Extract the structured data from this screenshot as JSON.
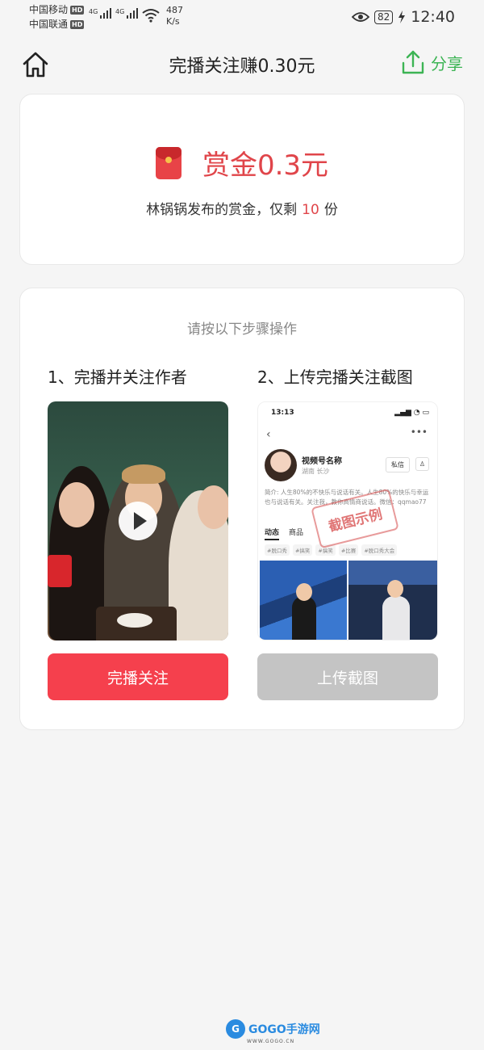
{
  "status_bar": {
    "carrier1": "中国移动",
    "carrier2": "中国联通",
    "hd": "HD",
    "network": "4G",
    "speed_value": "487",
    "speed_unit": "K/s",
    "battery": "82",
    "time": "12:40"
  },
  "header": {
    "title": "完播关注赚0.30元",
    "share_label": "分享",
    "accent_color": "#3cb454"
  },
  "bounty": {
    "amount_label": "赏金0.3元",
    "desc_prefix": "林锅锅发布的赏金，仅剩",
    "remaining": "10",
    "desc_suffix": "份",
    "accent_color": "#e0454a"
  },
  "steps": {
    "hint": "请按以下步骤操作",
    "step1_title": "1、完播并关注作者",
    "step2_title": "2、上传完播关注截图",
    "step1_button": "完播关注",
    "step2_button": "上传截图",
    "primary_color": "#f5404d",
    "disabled_color": "#c4c4c4"
  },
  "example": {
    "time": "13:13",
    "channel_name": "视频号名称",
    "location": "湖南 长沙",
    "dm_label": "私信",
    "bio": "简介: 人生80%的不快乐与说话有关。人生80%的快乐与幸运也与说话有关。关注我，教你高情商说话。微信：qqmao77",
    "tab_active": "动态",
    "tab_other": "商品",
    "tags": [
      "#脱口秀",
      "#搞笑",
      "#搞笑",
      "#比赛",
      "#脱口秀大会"
    ],
    "stamp": "截图示例"
  },
  "watermark": {
    "brand": "GOGO手游网",
    "url": "WWW.GOGO.CN"
  }
}
